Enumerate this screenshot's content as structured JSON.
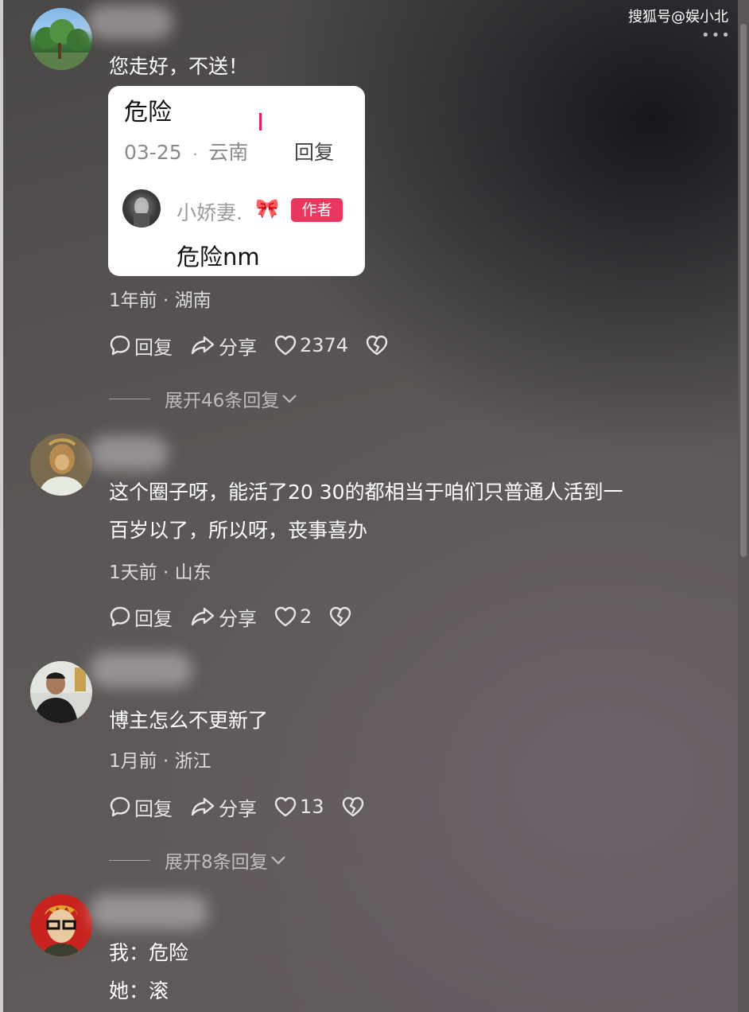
{
  "watermark": "搜狐号@娱小北",
  "comments": [
    {
      "text": "您走好，不送！",
      "quote": {
        "title": "危险",
        "date": "03-25",
        "sep": "·",
        "location": "云南",
        "reply_label": "回复",
        "author": "小娇妻.",
        "author_badge": "作者",
        "reply_text": "危险nm"
      },
      "meta": "1年前 · 湖南",
      "actions": {
        "reply": "回复",
        "share": "分享",
        "likes": "2374"
      },
      "expand": "展开46条回复"
    },
    {
      "text_lines": [
        "这个圈子呀，能活了20 30的都相当于咱们只普通人活到一",
        "百岁以了，所以呀，丧事喜办"
      ],
      "meta": "1天前 · 山东",
      "actions": {
        "reply": "回复",
        "share": "分享",
        "likes": "2"
      }
    },
    {
      "text": "博主怎么不更新了",
      "meta": "1月前 · 浙江",
      "actions": {
        "reply": "回复",
        "share": "分享",
        "likes": "13"
      },
      "expand": "展开8条回复"
    },
    {
      "text_lines": [
        "我：危险",
        "她：滚"
      ]
    }
  ],
  "icons": [
    "reply-icon",
    "share-icon",
    "like-icon",
    "dislike-icon",
    "chevron-down-icon",
    "more-icon"
  ]
}
